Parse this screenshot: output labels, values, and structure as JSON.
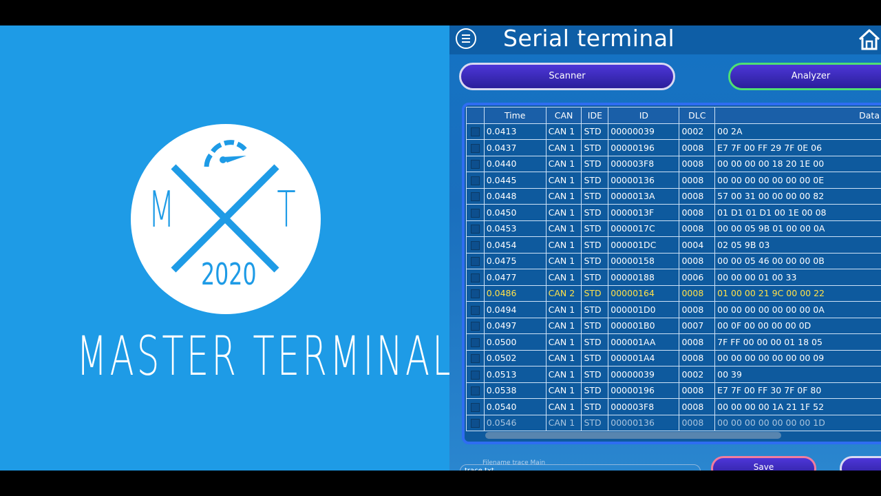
{
  "brand": {
    "logo_letter_left": "M",
    "logo_letter_right": "T",
    "logo_year": "2020",
    "name": "MASTER TERMINAL",
    "logo_color": "#1e9be6"
  },
  "app": {
    "title": "Serial terminal",
    "menu_icon": "hamburger-circle-icon",
    "home_icon": "home-icon",
    "buttons": {
      "scanner": "Scanner",
      "analyzer": "Analyzer",
      "save": "Save"
    },
    "filename": {
      "label": "Filename trace Main",
      "value": "trace.txt"
    }
  },
  "table": {
    "columns": [
      "Time",
      "CAN",
      "IDE",
      "ID",
      "DLC",
      "Data"
    ],
    "highlight_color": "#ffe14a",
    "rows": [
      {
        "time": "0.0413",
        "can": "CAN 1",
        "ide": "STD",
        "id": "00000039",
        "dlc": "0002",
        "data": "00 2A"
      },
      {
        "time": "0.0437",
        "can": "CAN 1",
        "ide": "STD",
        "id": "00000196",
        "dlc": "0008",
        "data": "E7 7F 00 FF 29 7F 0E 06"
      },
      {
        "time": "0.0440",
        "can": "CAN 1",
        "ide": "STD",
        "id": "000003F8",
        "dlc": "0008",
        "data": "00 00 00 00 18 20 1E 00"
      },
      {
        "time": "0.0445",
        "can": "CAN 1",
        "ide": "STD",
        "id": "00000136",
        "dlc": "0008",
        "data": "00 00 00 00 00 00 00 0E"
      },
      {
        "time": "0.0448",
        "can": "CAN 1",
        "ide": "STD",
        "id": "0000013A",
        "dlc": "0008",
        "data": "57 00 31 00 00 00 00 82"
      },
      {
        "time": "0.0450",
        "can": "CAN 1",
        "ide": "STD",
        "id": "0000013F",
        "dlc": "0008",
        "data": "01 D1 01 D1 00 1E 00 08"
      },
      {
        "time": "0.0453",
        "can": "CAN 1",
        "ide": "STD",
        "id": "0000017C",
        "dlc": "0008",
        "data": "00 00 05 9B 01 00 00 0A"
      },
      {
        "time": "0.0454",
        "can": "CAN 1",
        "ide": "STD",
        "id": "000001DC",
        "dlc": "0004",
        "data": "02 05 9B 03"
      },
      {
        "time": "0.0475",
        "can": "CAN 1",
        "ide": "STD",
        "id": "00000158",
        "dlc": "0008",
        "data": "00 00 05 46 00 00 00 0B"
      },
      {
        "time": "0.0477",
        "can": "CAN 1",
        "ide": "STD",
        "id": "00000188",
        "dlc": "0006",
        "data": "00 00 00 01 00 33"
      },
      {
        "time": "0.0486",
        "can": "CAN 2",
        "ide": "STD",
        "id": "00000164",
        "dlc": "0008",
        "data": "01 00 00 21 9C 00 00 22",
        "highlight": true
      },
      {
        "time": "0.0494",
        "can": "CAN 1",
        "ide": "STD",
        "id": "000001D0",
        "dlc": "0008",
        "data": "00 00 00 00 00 00 00 0A"
      },
      {
        "time": "0.0497",
        "can": "CAN 1",
        "ide": "STD",
        "id": "000001B0",
        "dlc": "0007",
        "data": "00 0F 00 00 00 00 0D"
      },
      {
        "time": "0.0500",
        "can": "CAN 1",
        "ide": "STD",
        "id": "000001AA",
        "dlc": "0008",
        "data": "7F FF 00 00 00 01 18 05"
      },
      {
        "time": "0.0502",
        "can": "CAN 1",
        "ide": "STD",
        "id": "000001A4",
        "dlc": "0008",
        "data": "00 00 00 00 00 00 00 09"
      },
      {
        "time": "0.0513",
        "can": "CAN 1",
        "ide": "STD",
        "id": "00000039",
        "dlc": "0002",
        "data": "00 39"
      },
      {
        "time": "0.0538",
        "can": "CAN 1",
        "ide": "STD",
        "id": "00000196",
        "dlc": "0008",
        "data": "E7 7F 00 FF 30 7F 0F 80"
      },
      {
        "time": "0.0540",
        "can": "CAN 1",
        "ide": "STD",
        "id": "000003F8",
        "dlc": "0008",
        "data": "00 00 00 00 1A 21 1F 52"
      },
      {
        "time": "0.0546",
        "can": "CAN 1",
        "ide": "STD",
        "id": "00000136",
        "dlc": "0008",
        "data": "00 00 00 00 00 00 00 1D",
        "faded": true
      }
    ]
  }
}
